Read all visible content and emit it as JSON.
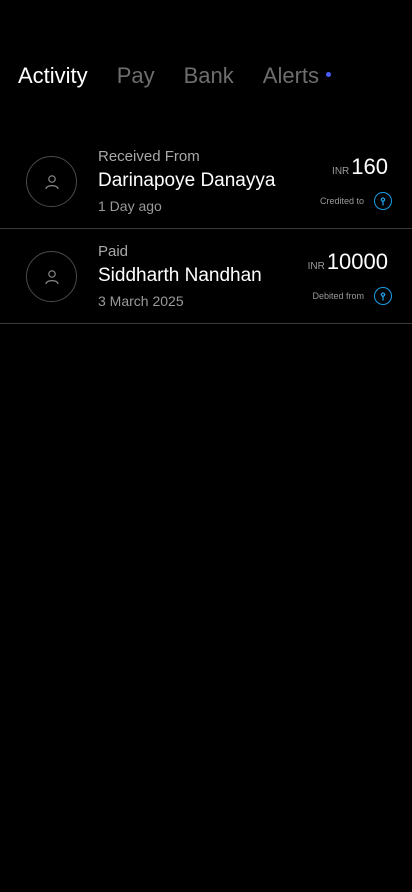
{
  "tabs": [
    {
      "label": "Activity",
      "active": true
    },
    {
      "label": "Pay",
      "active": false
    },
    {
      "label": "Bank",
      "active": false
    },
    {
      "label": "Alerts",
      "active": false
    }
  ],
  "alerts_dot_color": "#4a5cff",
  "accent_color": "#1a9ee6",
  "transactions": [
    {
      "type": "Received From",
      "name": "Darinapoye Danayya",
      "date": "1 Day ago",
      "currency": "INR",
      "amount": "160",
      "account_label": "Credited to",
      "icon": "person-icon",
      "bank_icon": "bank-icon"
    },
    {
      "type": "Paid",
      "name": "Siddharth Nandhan",
      "date": "3 March 2025",
      "currency": "INR",
      "amount": "10000",
      "account_label": "Debited from",
      "icon": "person-icon",
      "bank_icon": "bank-icon"
    }
  ]
}
